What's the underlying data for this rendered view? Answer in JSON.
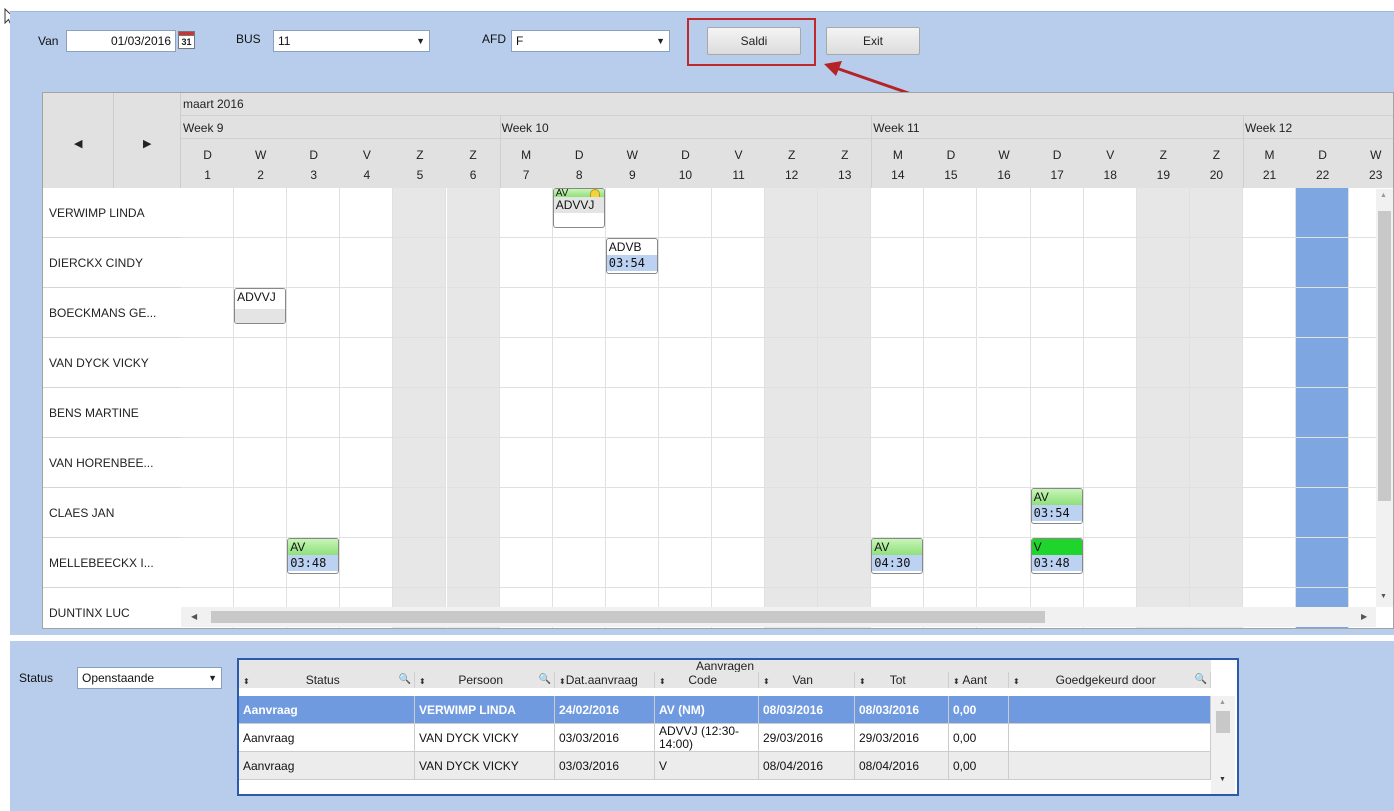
{
  "toolbar": {
    "van_label": "Van",
    "van_value": "01/03/2016",
    "calendar_day": "31",
    "bus_label": "BUS",
    "bus_value": "11",
    "afd_label": "AFD",
    "afd_value": "F",
    "saldi_label": "Saldi",
    "exit_label": "Exit"
  },
  "calendar": {
    "month_label": "maart 2016",
    "weeks": [
      "Week 9",
      "Week 10",
      "Week 11",
      "Week 12"
    ],
    "days": [
      {
        "d": "D",
        "n": "1"
      },
      {
        "d": "W",
        "n": "2"
      },
      {
        "d": "D",
        "n": "3"
      },
      {
        "d": "V",
        "n": "4"
      },
      {
        "d": "Z",
        "n": "5"
      },
      {
        "d": "Z",
        "n": "6"
      },
      {
        "d": "M",
        "n": "7"
      },
      {
        "d": "D",
        "n": "8"
      },
      {
        "d": "W",
        "n": "9"
      },
      {
        "d": "D",
        "n": "10"
      },
      {
        "d": "V",
        "n": "11"
      },
      {
        "d": "Z",
        "n": "12"
      },
      {
        "d": "Z",
        "n": "13"
      },
      {
        "d": "M",
        "n": "14"
      },
      {
        "d": "D",
        "n": "15"
      },
      {
        "d": "W",
        "n": "16"
      },
      {
        "d": "D",
        "n": "17"
      },
      {
        "d": "V",
        "n": "18"
      },
      {
        "d": "Z",
        "n": "19"
      },
      {
        "d": "Z",
        "n": "20"
      },
      {
        "d": "M",
        "n": "21"
      },
      {
        "d": "D",
        "n": "22"
      },
      {
        "d": "W",
        "n": "23"
      }
    ],
    "people": [
      "VERWIMP LINDA",
      "DIERCKX CINDY",
      "BOECKMANS GE...",
      "VAN DYCK VICKY",
      "BENS MARTINE",
      "VAN HORENBEE...",
      "CLAES JAN",
      "MELLEBEECKX I...",
      "DUNTINX LUC"
    ],
    "events": [
      {
        "row": 0,
        "day": 8,
        "top": "AV",
        "bottom": "ADVVJ",
        "style": "green-gray",
        "icon": true
      },
      {
        "row": 1,
        "day": 9,
        "top": "ADVB",
        "bottom": "03:54",
        "style": "white-blue"
      },
      {
        "row": 2,
        "day": 2,
        "top": "ADVVJ",
        "bottom": "",
        "style": "white-gray"
      },
      {
        "row": 6,
        "day": 17,
        "top": "AV",
        "bottom": "03:54",
        "style": "green-blue"
      },
      {
        "row": 7,
        "day": 3,
        "top": "AV",
        "bottom": "03:48",
        "style": "green-blue"
      },
      {
        "row": 7,
        "day": 14,
        "top": "AV",
        "bottom": "04:30",
        "style": "green-blue"
      },
      {
        "row": 7,
        "day": 17,
        "top": "V",
        "bottom": "03:48",
        "style": "bright-blue"
      }
    ]
  },
  "status": {
    "label": "Status",
    "value": "Openstaande"
  },
  "requests": {
    "title": "Aanvragen",
    "columns": [
      "Status",
      "Persoon",
      "Dat.aanvraag",
      "Code",
      "Van",
      "Tot",
      "Aant",
      "Goedgekeurd door"
    ],
    "rows": [
      [
        "Aanvraag",
        "VERWIMP LINDA",
        "24/02/2016",
        "AV (NM)",
        "08/03/2016",
        "08/03/2016",
        "0,00",
        ""
      ],
      [
        "Aanvraag",
        "VAN DYCK VICKY",
        "03/03/2016",
        "ADVVJ (12:30-14:00)",
        "29/03/2016",
        "29/03/2016",
        "0,00",
        ""
      ],
      [
        "Aanvraag",
        "VAN DYCK VICKY",
        "03/03/2016",
        "V",
        "08/04/2016",
        "08/04/2016",
        "0,00",
        ""
      ]
    ]
  },
  "colors": {
    "panel": "#b8cdec",
    "today": "#7ea6e0",
    "selected_row": "#6f9ae0",
    "highlight": "#c0282b"
  }
}
